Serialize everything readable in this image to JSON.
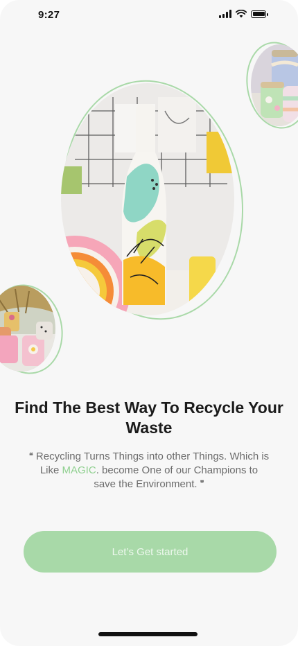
{
  "status_bar": {
    "time": "9:27"
  },
  "onboarding": {
    "title": "Find The Best Way To Recycle Your Waste",
    "subtitle_before": "Recycling Turns Things into other Things. Which is Like ",
    "subtitle_highlight": "MAGIC",
    "subtitle_after": ". become One of our Champions to save the Environment.",
    "open_quote": "❝",
    "close_quote": "❞",
    "cta_label": "Let’s Get started"
  },
  "colors": {
    "accent": "#a8d9a8",
    "highlight": "#8fd08f",
    "title": "#1b1b1b",
    "body": "#6b6b6b",
    "background": "#f7f7f7"
  },
  "icons": [
    "signal-icon",
    "wifi-icon",
    "battery-icon"
  ]
}
